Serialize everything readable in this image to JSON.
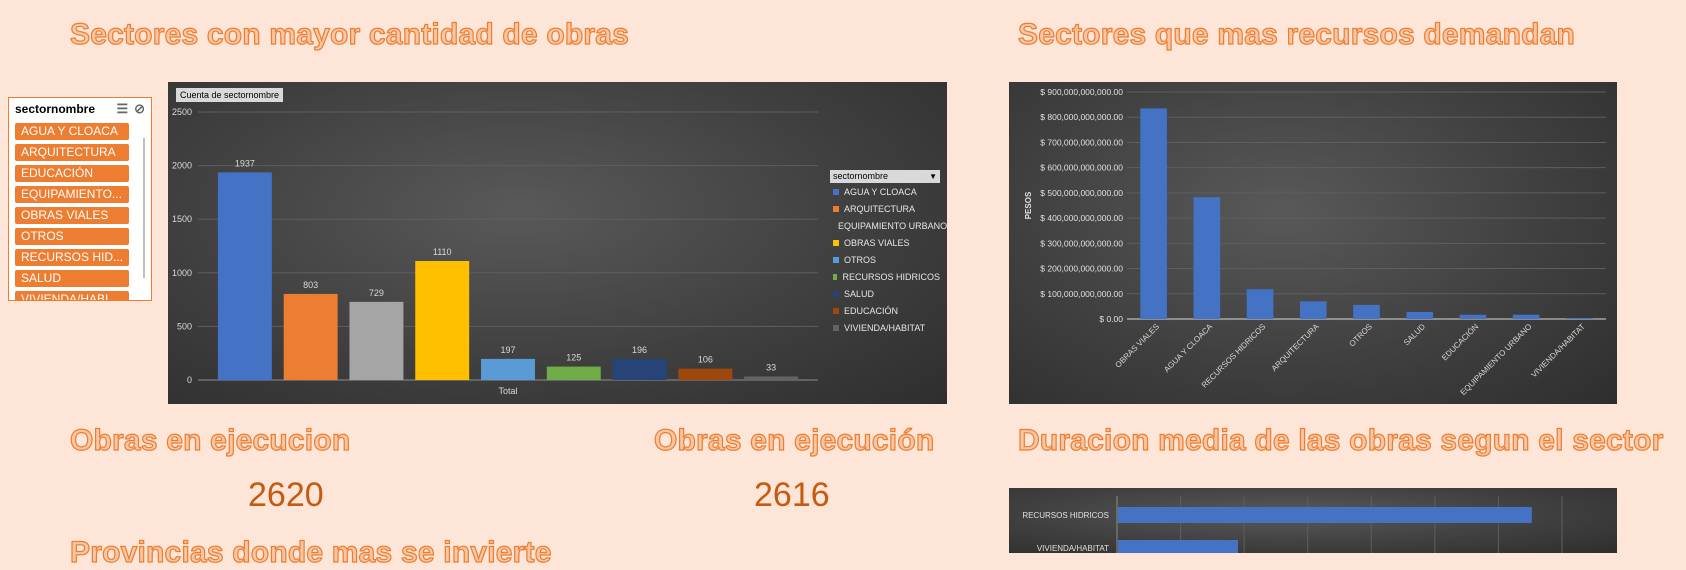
{
  "titles": {
    "sector_obras": "Sectores con mayor cantidad de obras",
    "sector_recursos": "Sectores que mas recursos demandan",
    "ejecucion_1": "Obras en ejecucion",
    "ejecucion_2": "Obras en ejecución",
    "duracion": "Duracion media de las obras segun el sector",
    "provincias": "Provincias donde mas se invierte"
  },
  "kpis": {
    "ejecucion_1": "2620",
    "ejecucion_2": "2616"
  },
  "slicer": {
    "title": "sectornombre",
    "items": [
      "AGUA Y CLOACA",
      "ARQUITECTURA",
      "EDUCACIÓN",
      "EQUIPAMIENTO...",
      "OBRAS VIALES",
      "OTROS",
      "RECURSOS HID...",
      "SALUD",
      "VIVIENDA/HABI..."
    ]
  },
  "chart_data": [
    {
      "type": "bar",
      "field_button": "Cuenta de sectornombre",
      "xlabel": "Total",
      "ylim": [
        0,
        2500
      ],
      "yticks": [
        "0",
        "500",
        "1000",
        "1500",
        "2000",
        "2500"
      ],
      "legend_title": "sectornombre",
      "legend_position": "right",
      "series": [
        {
          "name": "AGUA Y CLOACA",
          "value": 1937,
          "color": "#4472c4"
        },
        {
          "name": "ARQUITECTURA",
          "value": 803,
          "color": "#ed7d31"
        },
        {
          "name": "EQUIPAMIENTO URBANO",
          "value": 729,
          "color": "#a5a5a5"
        },
        {
          "name": "OBRAS VIALES",
          "value": 1110,
          "color": "#ffc000"
        },
        {
          "name": "OTROS",
          "value": 197,
          "color": "#5b9bd5"
        },
        {
          "name": "RECURSOS HIDRICOS",
          "value": 125,
          "color": "#70ad47"
        },
        {
          "name": "SALUD",
          "value": 196,
          "color": "#264478"
        },
        {
          "name": "EDUCACIÓN",
          "value": 106,
          "color": "#9e480e"
        },
        {
          "name": "VIVIENDA/HABITAT",
          "value": 33,
          "color": "#636363"
        }
      ]
    },
    {
      "type": "bar",
      "ylabel": "PESOS",
      "ylim": [
        0,
        900000000000
      ],
      "yticks": [
        "$ 0.00",
        "$ 100,000,000,000.00",
        "$ 200,000,000,000.00",
        "$ 300,000,000,000.00",
        "$ 400,000,000,000.00",
        "$ 500,000,000,000.00",
        "$ 600,000,000,000.00",
        "$ 700,000,000,000.00",
        "$ 800,000,000,000.00",
        "$ 900,000,000,000.00"
      ],
      "categories": [
        "OBRAS VIALES",
        "AGUA Y CLOACA",
        "RECURSOS HIDRICOS",
        "ARQUITECTURA",
        "OTROS",
        "SALUD",
        "EDUCACIÓN",
        "EQUIPAMIENTO URBANO",
        "VIVIENDA/HABITAT"
      ],
      "values": [
        835000000000,
        483000000000,
        118000000000,
        70000000000,
        56000000000,
        28000000000,
        17000000000,
        17000000000,
        4000000000
      ],
      "color": "#4472c4"
    },
    {
      "type": "bar",
      "orientation": "horizontal",
      "categories": [
        "RECURSOS HIDRICOS",
        "VIVIENDA/HABITAT"
      ],
      "values": [
        1.0,
        0.29
      ],
      "color": "#4472c4"
    }
  ]
}
